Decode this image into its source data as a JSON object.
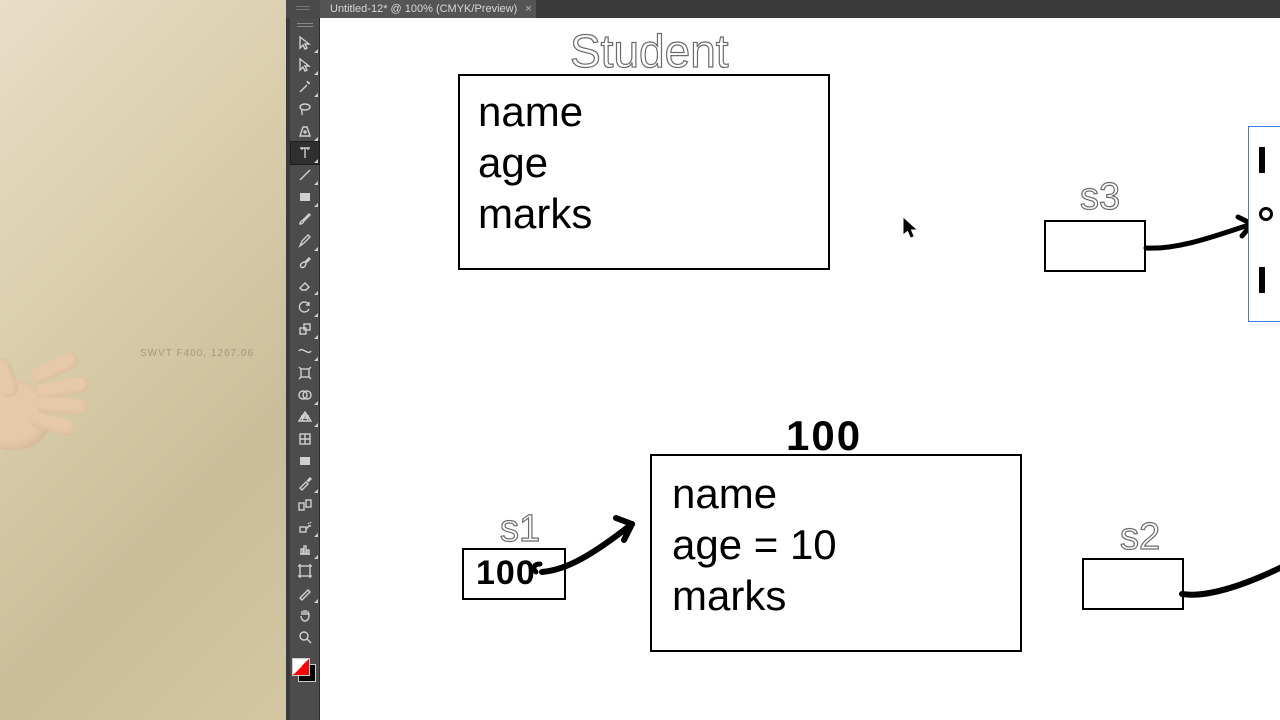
{
  "tab": {
    "title": "Untitled-12* @ 100% (CMYK/Preview)",
    "close_glyph": "×"
  },
  "desktop": {
    "watermark": "SWVT F400, 1267.06"
  },
  "tools": [
    {
      "name": "selection-tool-icon",
      "selected": false
    },
    {
      "name": "direct-selection-tool-icon",
      "selected": false
    },
    {
      "name": "magic-wand-tool-icon",
      "selected": false
    },
    {
      "name": "lasso-tool-icon",
      "selected": false
    },
    {
      "name": "pen-tool-icon",
      "selected": false
    },
    {
      "name": "type-tool-icon",
      "selected": true
    },
    {
      "name": "line-segment-tool-icon",
      "selected": false
    },
    {
      "name": "rectangle-tool-icon",
      "selected": false
    },
    {
      "name": "paintbrush-tool-icon",
      "selected": false
    },
    {
      "name": "pencil-tool-icon",
      "selected": false
    },
    {
      "name": "blob-brush-tool-icon",
      "selected": false
    },
    {
      "name": "eraser-tool-icon",
      "selected": false
    },
    {
      "name": "rotate-tool-icon",
      "selected": false
    },
    {
      "name": "scale-tool-icon",
      "selected": false
    },
    {
      "name": "width-tool-icon",
      "selected": false
    },
    {
      "name": "free-transform-tool-icon",
      "selected": false
    },
    {
      "name": "shape-builder-tool-icon",
      "selected": false
    },
    {
      "name": "perspective-grid-tool-icon",
      "selected": false
    },
    {
      "name": "mesh-tool-icon",
      "selected": false
    },
    {
      "name": "gradient-tool-icon",
      "selected": false
    },
    {
      "name": "eyedropper-tool-icon",
      "selected": false
    },
    {
      "name": "blend-tool-icon",
      "selected": false
    },
    {
      "name": "symbol-sprayer-tool-icon",
      "selected": false
    },
    {
      "name": "column-graph-tool-icon",
      "selected": false
    },
    {
      "name": "artboard-tool-icon",
      "selected": false
    },
    {
      "name": "slice-tool-icon",
      "selected": false
    },
    {
      "name": "hand-tool-icon",
      "selected": false
    },
    {
      "name": "zoom-tool-icon",
      "selected": false
    }
  ],
  "diagram": {
    "class_title": "Student",
    "class_fields": "name\nage\nmarks",
    "s3_label": "s3",
    "addr_100_top": "100",
    "instance_fields": "name\nage = 10\nmarks",
    "s1_label": "s1",
    "s1_value": "100",
    "s2_label": "s2"
  }
}
